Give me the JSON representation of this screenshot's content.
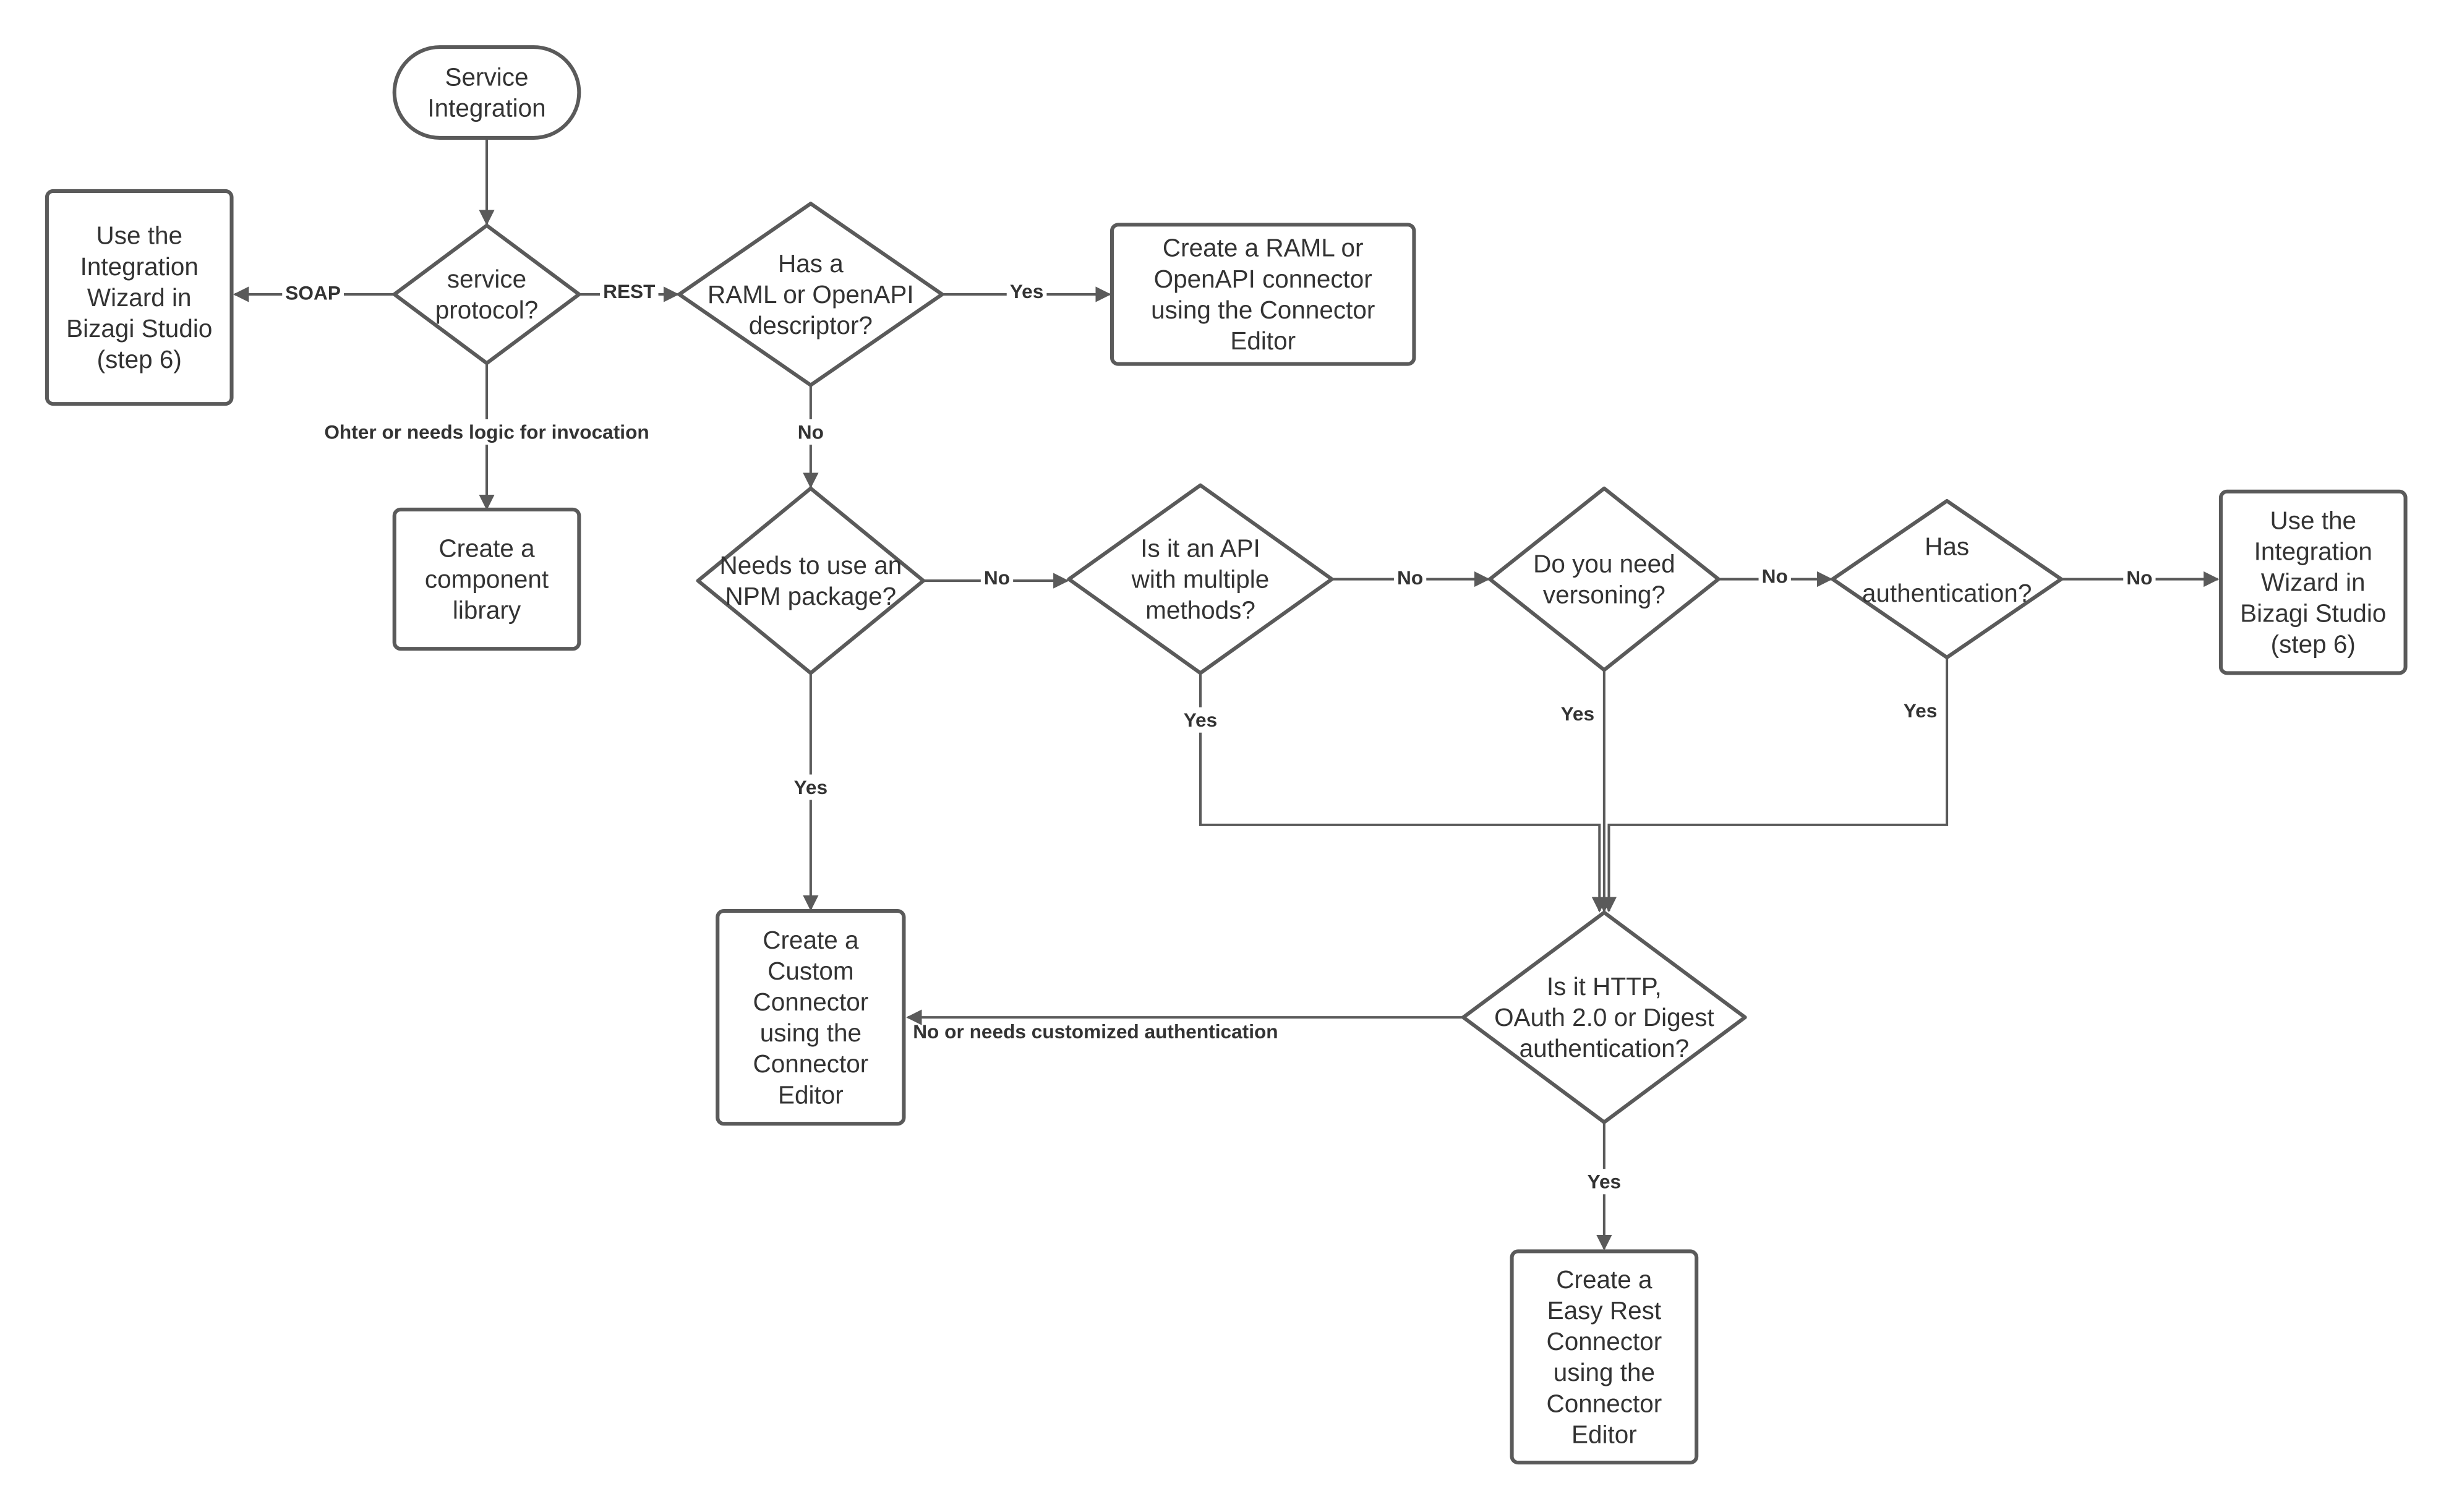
{
  "colors": {
    "stroke": "#5a5a5a",
    "text": "#333333",
    "background": "#ffffff"
  },
  "nodes": {
    "start": {
      "type": "terminator",
      "lines": [
        "Service",
        "Integration"
      ]
    },
    "protocol": {
      "type": "decision",
      "lines": [
        "service",
        "protocol?"
      ]
    },
    "soap_wizard": {
      "type": "process",
      "lines": [
        "Use the",
        "Integration",
        "Wizard in",
        "Bizagi Studio",
        "(step 6)"
      ]
    },
    "component": {
      "type": "process",
      "lines": [
        "Create a",
        "component",
        "library"
      ]
    },
    "raml": {
      "type": "decision",
      "lines": [
        "Has a",
        "RAML or OpenAPI",
        "descriptor?"
      ]
    },
    "raml_connector": {
      "type": "process",
      "lines": [
        "Create a RAML or",
        "OpenAPI connector",
        "using the Connector",
        "Editor"
      ]
    },
    "npm": {
      "type": "decision",
      "lines": [
        "Needs to use an",
        "NPM package?"
      ]
    },
    "api": {
      "type": "decision",
      "lines": [
        "Is it an API",
        "with multiple",
        "methods?"
      ]
    },
    "versioning": {
      "type": "decision",
      "lines": [
        "Do you need",
        "versoning?"
      ]
    },
    "auth": {
      "type": "decision",
      "lines": [
        "Has",
        "authentication?"
      ]
    },
    "auth_wizard": {
      "type": "process",
      "lines": [
        "Use the",
        "Integration",
        "Wizard in",
        "Bizagi Studio",
        "(step 6)"
      ]
    },
    "custom": {
      "type": "process",
      "lines": [
        "Create a",
        "Custom",
        "Connector",
        "using the",
        "Connector",
        "Editor"
      ]
    },
    "http": {
      "type": "decision",
      "lines": [
        "Is it HTTP,",
        "OAuth 2.0 or Digest",
        "authentication?"
      ]
    },
    "easy": {
      "type": "process",
      "lines": [
        "Create a",
        "Easy Rest",
        "Connector",
        "using the",
        "Connector",
        "Editor"
      ]
    }
  },
  "edges": {
    "start_protocol": "",
    "protocol_soap": "SOAP",
    "protocol_rest": "REST",
    "protocol_other": "Ohter or needs logic for invocation",
    "raml_yes": "Yes",
    "raml_no": "No",
    "npm_no": "No",
    "npm_yes": "Yes",
    "api_no": "No",
    "api_yes": "Yes",
    "versioning_no": "No",
    "versioning_yes": "Yes",
    "auth_no": "No",
    "auth_yes": "Yes",
    "http_no": "No or needs customized authentication",
    "http_yes": "Yes"
  }
}
